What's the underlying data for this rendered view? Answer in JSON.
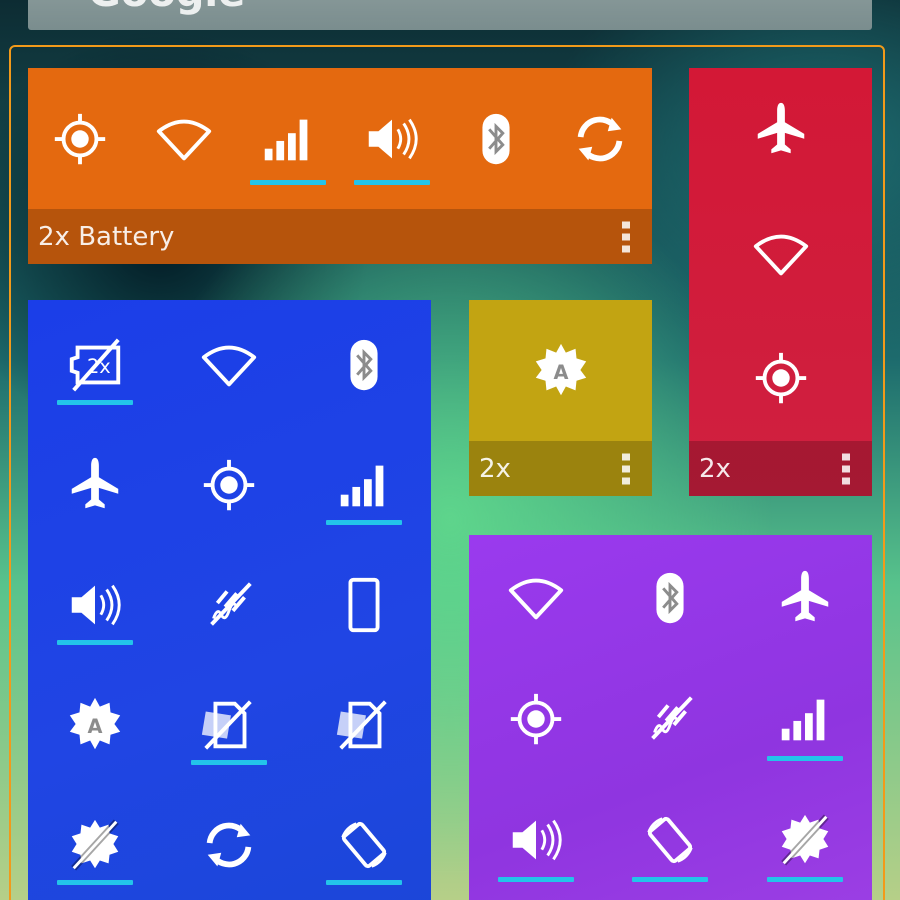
{
  "search_bar": {
    "logo_text": "Google",
    "mic_icon": "mic-icon"
  },
  "colors": {
    "orange": "#e4690f",
    "red": "#d31836",
    "yellow": "#c2a412",
    "blue": "#1f42e6",
    "purple": "#9a3aee",
    "indicator": "#23c4ea",
    "frame": "#f29a1a"
  },
  "widgets": {
    "orange": {
      "footer_label": "2x Battery",
      "toggles": [
        {
          "icon": "gps-icon",
          "active": false
        },
        {
          "icon": "wifi-icon",
          "active": false
        },
        {
          "icon": "signal-icon",
          "active": true
        },
        {
          "icon": "volume-icon",
          "active": true
        },
        {
          "icon": "bluetooth-icon",
          "active": false
        },
        {
          "icon": "sync-icon",
          "active": false
        }
      ]
    },
    "red": {
      "footer_label": "2x",
      "toggles": [
        {
          "icon": "airplane-icon",
          "active": false
        },
        {
          "icon": "wifi-icon",
          "active": false
        },
        {
          "icon": "gps-icon",
          "active": false
        }
      ]
    },
    "yellow": {
      "footer_label": "2x",
      "toggles": [
        {
          "icon": "auto-brightness-icon",
          "active": false
        }
      ]
    },
    "blue": {
      "toggles": [
        {
          "icon": "battery-2x-icon",
          "active": true
        },
        {
          "icon": "wifi-icon",
          "active": false
        },
        {
          "icon": "bluetooth-icon",
          "active": false
        },
        {
          "icon": "airplane-icon",
          "active": false
        },
        {
          "icon": "gps-icon",
          "active": false
        },
        {
          "icon": "signal-icon",
          "active": true
        },
        {
          "icon": "volume-icon",
          "active": true
        },
        {
          "icon": "vibrate-off-icon",
          "active": false
        },
        {
          "icon": "phone-frame-icon",
          "active": false
        },
        {
          "icon": "auto-brightness-icon",
          "active": false
        },
        {
          "icon": "sim-off-icon",
          "active": true
        },
        {
          "icon": "sim-off-icon",
          "active": false
        },
        {
          "icon": "brightness-off-icon",
          "active": true
        },
        {
          "icon": "sync-icon",
          "active": false
        },
        {
          "icon": "rotate-icon",
          "active": true
        }
      ]
    },
    "purple": {
      "toggles": [
        {
          "icon": "wifi-icon",
          "active": false
        },
        {
          "icon": "bluetooth-icon",
          "active": false
        },
        {
          "icon": "airplane-icon",
          "active": false
        },
        {
          "icon": "gps-icon",
          "active": false
        },
        {
          "icon": "vibrate-off-icon",
          "active": false
        },
        {
          "icon": "signal-icon",
          "active": true
        },
        {
          "icon": "volume-icon",
          "active": true
        },
        {
          "icon": "rotate-icon",
          "active": true
        },
        {
          "icon": "brightness-off-icon",
          "active": true
        }
      ]
    }
  }
}
